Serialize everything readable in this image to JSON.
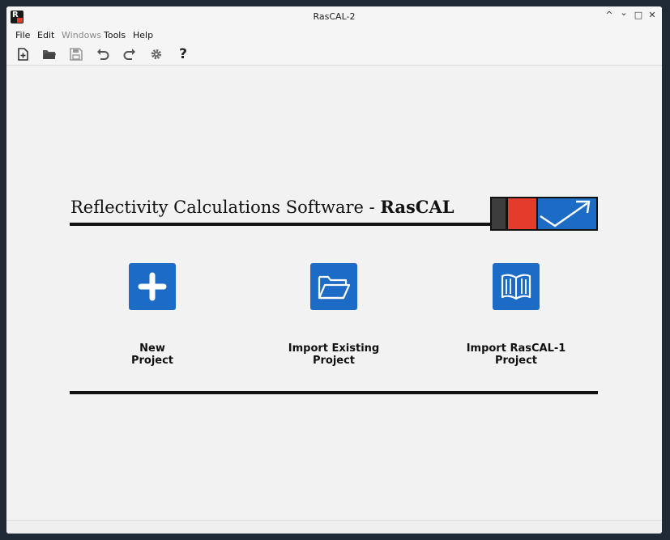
{
  "window": {
    "title": "RasCAL-2"
  },
  "window_controls": [
    {
      "name": "shade",
      "glyph": "^"
    },
    {
      "name": "minimize",
      "glyph": "⌄"
    },
    {
      "name": "maximize",
      "glyph": "□"
    },
    {
      "name": "close",
      "glyph": "✕"
    }
  ],
  "menu": [
    {
      "label": "File",
      "enabled": true
    },
    {
      "label": "Edit",
      "enabled": true
    },
    {
      "label": "Windows",
      "enabled": false
    },
    {
      "label": "Tools",
      "enabled": true
    },
    {
      "label": "Help",
      "enabled": true
    }
  ],
  "toolbar": {
    "icons": [
      "new-file-icon",
      "open-folder-icon",
      "save-icon",
      "undo-icon",
      "redo-icon",
      "settings-gear-icon",
      "help-question-icon"
    ],
    "help_glyph": "?"
  },
  "banner": {
    "title_prefix": "Reflectivity Calculations Software - ",
    "title_bold": "RasCAL",
    "logo_colors": {
      "dark": "#3d3d3d",
      "red": "#e53b2c",
      "blue": "#1c6bc5"
    }
  },
  "actions": [
    {
      "label_line1": "New",
      "label_line2": "Project",
      "icon": "plus-icon"
    },
    {
      "label_line1": "Import Existing",
      "label_line2": "Project",
      "icon": "folder-open-icon"
    },
    {
      "label_line1": "Import RasCAL-1",
      "label_line2": "Project",
      "icon": "open-book-icon"
    }
  ],
  "colors": {
    "accent": "#1c6bc5",
    "background": "#f2f2f2",
    "text": "#111111"
  }
}
